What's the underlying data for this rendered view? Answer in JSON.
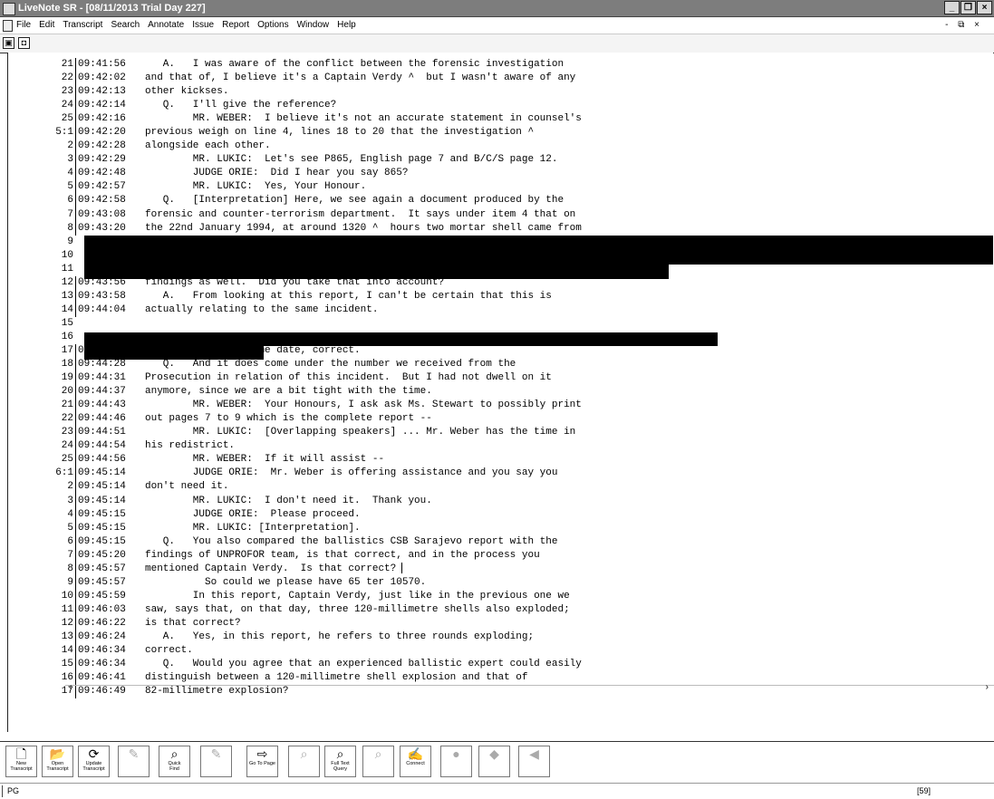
{
  "window": {
    "title": "LiveNote SR - [08/11/2013  Trial Day 227]"
  },
  "menu": [
    "File",
    "Edit",
    "Transcript",
    "Search",
    "Annotate",
    "Issue",
    "Report",
    "Options",
    "Window",
    "Help"
  ],
  "mdi_controls": "- ⧉ ×",
  "toolbar1": {
    "btn1": "▣",
    "btn2": "◘"
  },
  "transcript": {
    "lines": [
      {
        "ln": "21",
        "ts": "09:41:56",
        "text": "   A.   I was aware of the conflict between the forensic investigation"
      },
      {
        "ln": "22",
        "ts": "09:42:02",
        "text": "and that of, I believe it's a Captain Verdy ^  but I wasn't aware of any"
      },
      {
        "ln": "23",
        "ts": "09:42:13",
        "text": "other kickses."
      },
      {
        "ln": "24",
        "ts": "09:42:14",
        "text": "   Q.   I'll give the reference?"
      },
      {
        "ln": "25",
        "ts": "09:42:16",
        "text": "        MR. WEBER:  I believe it's not an accurate statement in counsel's"
      },
      {
        "ln": "5:1",
        "ts": "09:42:20",
        "text": "previous weigh on line 4, lines 18 to 20 that the investigation ^"
      },
      {
        "ln": "2",
        "ts": "09:42:28",
        "text": "alongside each other."
      },
      {
        "ln": "3",
        "ts": "09:42:29",
        "text": "        MR. LUKIC:  Let's see P865, English page 7 and B/C/S page 12."
      },
      {
        "ln": "4",
        "ts": "09:42:48",
        "text": "        JUDGE ORIE:  Did I hear you say 865?"
      },
      {
        "ln": "5",
        "ts": "09:42:57",
        "text": "        MR. LUKIC:  Yes, Your Honour."
      },
      {
        "ln": "6",
        "ts": "09:42:58",
        "text": "   Q.   [Interpretation] Here, we see again a document produced by the"
      },
      {
        "ln": "7",
        "ts": "09:43:08",
        "text": "forensic and counter-terrorism department.  It says under item 4 that on"
      },
      {
        "ln": "8",
        "ts": "09:43:20",
        "text": "the 22nd January 1994, at around 1320 ^  hours two mortar shell came from"
      },
      {
        "ln": "9",
        "ts": "",
        "text": ""
      },
      {
        "ln": "10",
        "ts": "",
        "text": ""
      },
      {
        "ln": "11",
        "ts": "",
        "text": ""
      },
      {
        "ln": "12",
        "ts": "09:43:56",
        "text": "findings as well.  Did you take that into account?"
      },
      {
        "ln": "13",
        "ts": "09:43:58",
        "text": "   A.   From looking at this report, I can't be certain that this is"
      },
      {
        "ln": "14",
        "ts": "09:44:04",
        "text": "actually relating to the same incident."
      },
      {
        "ln": "15",
        "ts": "",
        "text": ""
      },
      {
        "ln": "16",
        "ts": "",
        "text": ""
      },
      {
        "ln": "17",
        "ts": "09:44:28",
        "text": "   A.   It's the same date, correct."
      },
      {
        "ln": "18",
        "ts": "09:44:28",
        "text": "   Q.   And it does come under the number we received from the"
      },
      {
        "ln": "19",
        "ts": "09:44:31",
        "text": "Prosecution in relation of this incident.  But I had not dwell on it"
      },
      {
        "ln": "20",
        "ts": "09:44:37",
        "text": "anymore, since we are a bit tight with the time."
      },
      {
        "ln": "21",
        "ts": "09:44:43",
        "text": "        MR. WEBER:  Your Honours, I ask ask Ms. Stewart to possibly print"
      },
      {
        "ln": "22",
        "ts": "09:44:46",
        "text": "out pages 7 to 9 which is the complete report --"
      },
      {
        "ln": "23",
        "ts": "09:44:51",
        "text": "        MR. LUKIC:  [Overlapping speakers] ... Mr. Weber has the time in"
      },
      {
        "ln": "24",
        "ts": "09:44:54",
        "text": "his redistrict."
      },
      {
        "ln": "25",
        "ts": "09:44:56",
        "text": "        MR. WEBER:  If it will assist --"
      },
      {
        "ln": "6:1",
        "ts": "09:45:14",
        "text": "        JUDGE ORIE:  Mr. Weber is offering assistance and you say you"
      },
      {
        "ln": "2",
        "ts": "09:45:14",
        "text": "don't need it."
      },
      {
        "ln": "3",
        "ts": "09:45:14",
        "text": "        MR. LUKIC:  I don't need it.  Thank you."
      },
      {
        "ln": "4",
        "ts": "09:45:15",
        "text": "        JUDGE ORIE:  Please proceed."
      },
      {
        "ln": "5",
        "ts": "09:45:15",
        "text": "        MR. LUKIC: [Interpretation]."
      },
      {
        "ln": "6",
        "ts": "09:45:15",
        "text": "   Q.   You also compared the ballistics CSB Sarajevo report with the"
      },
      {
        "ln": "7",
        "ts": "09:45:20",
        "text": "findings of UNPROFOR team, is that correct, and in the process you"
      },
      {
        "ln": "8",
        "ts": "09:45:57",
        "text": "mentioned Captain Verdy.  Is that correct?"
      },
      {
        "ln": "9",
        "ts": "09:45:57",
        "text": "          So could we please have 65 ter 10570."
      },
      {
        "ln": "10",
        "ts": "09:45:59",
        "text": "        In this report, Captain Verdy, just like in the previous one we"
      },
      {
        "ln": "11",
        "ts": "09:46:03",
        "text": "saw, says that, on that day, three 120-millimetre shells also exploded;"
      },
      {
        "ln": "12",
        "ts": "09:46:22",
        "text": "is that correct?"
      },
      {
        "ln": "13",
        "ts": "09:46:24",
        "text": "   A.   Yes, in this report, he refers to three rounds exploding;"
      },
      {
        "ln": "14",
        "ts": "09:46:34",
        "text": "correct."
      },
      {
        "ln": "15",
        "ts": "09:46:34",
        "text": "   Q.   Would you agree that an experienced ballistic expert could easily"
      },
      {
        "ln": "16",
        "ts": "09:46:41",
        "text": "distinguish between a 120-millimetre shell explosion and that of"
      },
      {
        "ln": "17",
        "ts": "09:46:49",
        "text": "82-millimetre explosion?"
      }
    ]
  },
  "scroll": {
    "left_arrow": "‹",
    "right_arrow": "›"
  },
  "toolbar2": [
    {
      "icon": "🗋",
      "label": "New\nTranscript",
      "enabled": true
    },
    {
      "icon": "📂",
      "label": "Open\nTranscript",
      "enabled": true
    },
    {
      "icon": "⟳",
      "label": "Update\nTranscript",
      "enabled": true
    },
    {
      "icon": "✎",
      "label": "",
      "enabled": false
    },
    {
      "icon": "⌕",
      "label": "Quick\nFind",
      "enabled": true
    },
    {
      "icon": "✎",
      "label": "",
      "enabled": false
    },
    {
      "icon": "⇨",
      "label": "Go To Page",
      "enabled": true
    },
    {
      "icon": "⌕",
      "label": "",
      "enabled": false
    },
    {
      "icon": "⌕",
      "label": "Full Text\nQuery",
      "enabled": true
    },
    {
      "icon": "⌕",
      "label": "",
      "enabled": false
    },
    {
      "icon": "✍",
      "label": "Connect",
      "enabled": true
    },
    {
      "icon": "●",
      "label": "",
      "enabled": false
    },
    {
      "icon": "◆",
      "label": "",
      "enabled": false
    },
    {
      "icon": "◀",
      "label": "",
      "enabled": false
    }
  ],
  "status": {
    "left": "PG",
    "right": "[59]"
  }
}
